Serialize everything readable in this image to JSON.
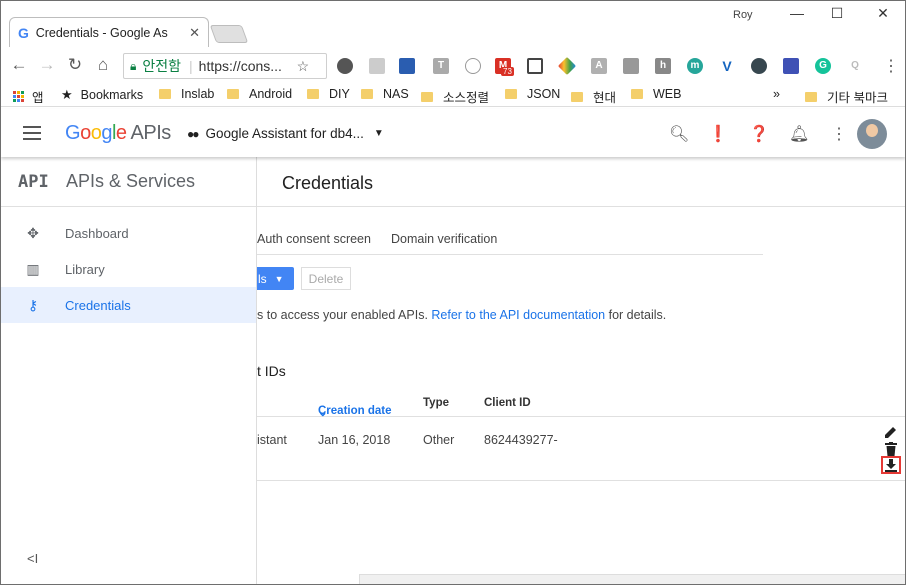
{
  "browser": {
    "tab_title": "Credentials - Google As",
    "tab_favicon": "G",
    "user_name": "Roy",
    "window_controls": {
      "minimize": "—",
      "maximize": "☐",
      "close": "✕"
    },
    "omnibox": {
      "secure_label": "안전함",
      "url": "https://cons..."
    },
    "extension_badge": "73"
  },
  "bookmarks": {
    "apps_label": "앱",
    "items": [
      "Bookmarks",
      "Inslab",
      "Android",
      "DIY",
      "NAS",
      "소스정렬",
      "JSON",
      "현대",
      "WEB"
    ],
    "overflow": "»",
    "other": "기타 북마크"
  },
  "header": {
    "logo_google": "Google",
    "logo_apis": "APIs",
    "project_name": "Google Assistant for db4..."
  },
  "sidebar": {
    "api_mark": "API",
    "title": "APIs & Services",
    "items": [
      {
        "label": "Dashboard",
        "icon": "dashboard-icon"
      },
      {
        "label": "Library",
        "icon": "library-icon"
      },
      {
        "label": "Credentials",
        "icon": "key-icon"
      }
    ],
    "collapse": "<I"
  },
  "main": {
    "title": "Credentials",
    "tabs": [
      "Auth consent screen",
      "Domain verification"
    ],
    "create_button": "ls",
    "delete_button": "Delete",
    "info_prefix": "s to access your enabled APIs. ",
    "info_link": "Refer to the API documentation",
    "info_suffix": " for details.",
    "section_title": "t IDs",
    "table": {
      "headers": [
        "Creation date",
        "Type",
        "Client ID"
      ],
      "sort_indicator": "⌄",
      "rows": [
        {
          "name": "istant",
          "date": "Jan 16, 2018",
          "type": "Other",
          "client_id": "8624439277-"
        }
      ]
    }
  }
}
